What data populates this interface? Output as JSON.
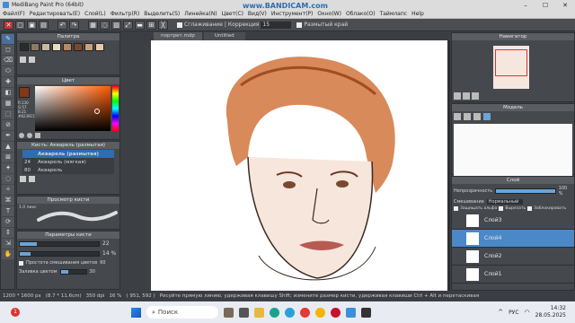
{
  "window": {
    "title": "MediBang Paint Pro (64bit)",
    "controls": [
      "–",
      "☐",
      "✕"
    ]
  },
  "watermark": "www.BANDICAM.com",
  "menu": [
    "Файл(F)",
    "Редактировать(E)",
    "Слой(L)",
    "Фильтр(R)",
    "Выделить(S)",
    "Линейка(N)",
    "Цвет(C)",
    "Вид(V)",
    "Инструмент(P)",
    "Окно(W)",
    "Облако(O)",
    "Таймлапс",
    "Help"
  ],
  "toolbar": {
    "smoothing_label": "Сглаживание",
    "correction_label": "Коррекция",
    "correction_value": "15",
    "blur_edge_label": "Размытый край"
  },
  "tabs": {
    "file": "портрет.mdp",
    "untitled": "Untitled"
  },
  "palette": {
    "title": "Палитра",
    "swatches": [
      "#2b2b2b",
      "#8a7a66",
      "#c9b89a",
      "#e9dcc5",
      "#b98860",
      "#7a4a2a",
      "#c6a37c",
      "#e8c8a8"
    ]
  },
  "color": {
    "title": "Цвет",
    "current": "#823915",
    "readout": "R:130\nG:57\nB:21\n#823915"
  },
  "brush": {
    "title": "Кисть: Акварель (размытая)",
    "items": [
      {
        "size": "",
        "name": "Акварель (размытая)",
        "selected": true
      },
      {
        "size": "24",
        "name": "Акварель (мягкая)",
        "selected": false
      },
      {
        "size": "80",
        "name": "Акварель",
        "selected": false
      }
    ]
  },
  "brush_preview": {
    "title": "Просмотр кисти",
    "size_label": "1.0 пикс"
  },
  "brush_params": {
    "title": "Параметры кисти",
    "size_value": "22",
    "opacity_value": "14 %",
    "size_fill": 0.22,
    "opacity_fill": 0.14,
    "mix_label": "Простота смешивания цветов",
    "mix_value": "60",
    "fill_label": "Заливка цветом",
    "fill_value": "30"
  },
  "navigator": {
    "title": "Навигатор"
  },
  "model": {
    "title": "Модель"
  },
  "layers": {
    "title": "Слой",
    "opacity_label": "Непрозрачность",
    "opacity_value": "100 %",
    "opacity_fill": 1.0,
    "blend_label": "Смешивание",
    "blend_value": "Нормальный",
    "protect_alpha": "Защищать альфа",
    "clip": "Вырезать",
    "lock": "Заблокировать",
    "items": [
      {
        "name": "Слой3",
        "selected": false
      },
      {
        "name": "Слой4",
        "selected": true
      },
      {
        "name": "Слой2",
        "selected": false
      },
      {
        "name": "Слой1",
        "selected": false
      }
    ]
  },
  "status": {
    "size": "1200 * 1600 px",
    "dims": "(8.7 * 11.6cm)",
    "dpi": "350 dpi",
    "zoom": "16 %",
    "coords": "( 951, 592 )",
    "hint": "Рисуйте прямую линию, удерживая клавишу Shift; измените размер кисти, удерживая клавиши Ctrl + Alt и перетаскивая"
  },
  "taskbar": {
    "search_placeholder": "Поиск",
    "lang": "РУС",
    "time": "14:32",
    "date": "28.05.2025",
    "notif": "1"
  }
}
